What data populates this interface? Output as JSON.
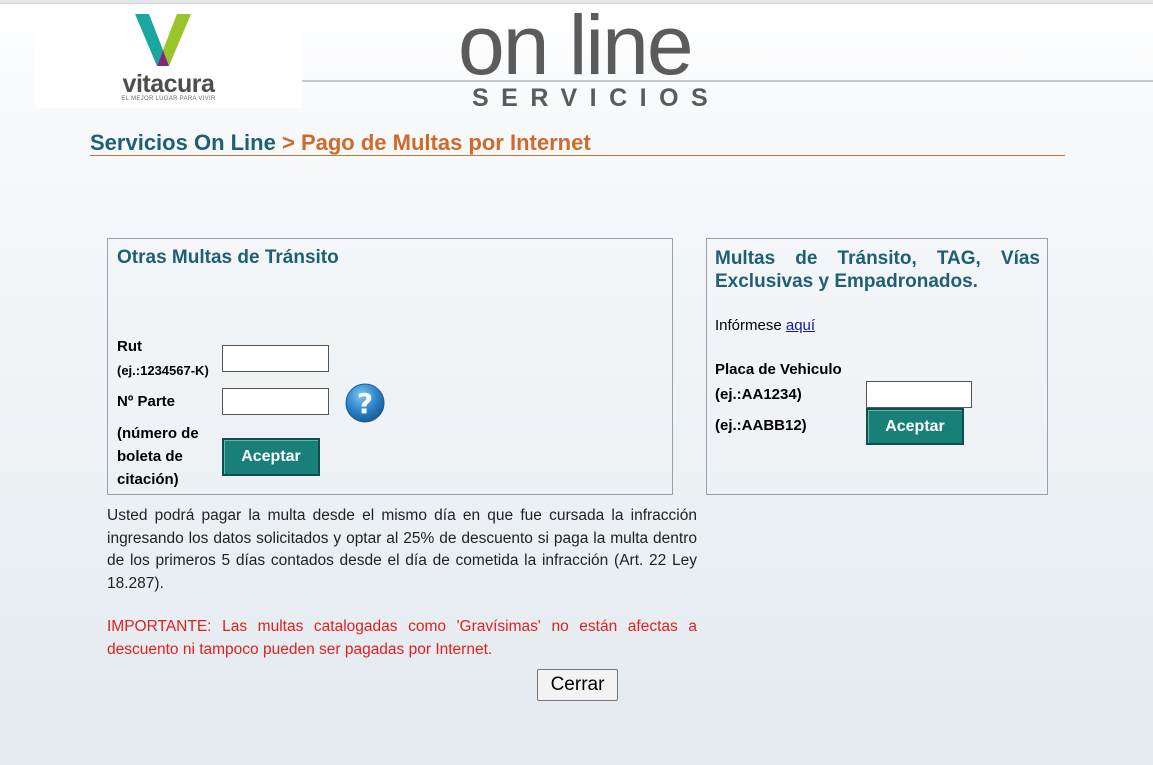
{
  "header": {
    "logo_text": "vitacura",
    "logo_tagline": "EL MEJOR LUGAR PARA VIVIR",
    "title_main": "on line",
    "title_sub": "SERVICIOS"
  },
  "breadcrumb": {
    "home": "Servicios On Line",
    "separator": ">",
    "current": "Pago de Multas por Internet"
  },
  "left_panel": {
    "title": "Otras Multas de Tránsito",
    "rut_label": "Rut",
    "rut_example": "(ej.:1234567-K)",
    "rut_value": "",
    "parte_label": "Nº Parte",
    "parte_value": "",
    "parte_note": [
      "(número de",
      "boleta de",
      "citación)"
    ],
    "submit_label": "Aceptar"
  },
  "right_panel": {
    "title": "Multas de Tránsito, TAG, Vías Exclusivas y Empadronados.",
    "info_prefix": "Infórmese",
    "info_link": "aquí",
    "placa_label": "Placa de Vehiculo",
    "placa_example_1": "(ej.:AA1234)",
    "placa_example_2": "(ej.:AABB12)",
    "placa_value": "",
    "submit_label": "Aceptar"
  },
  "info_text": "Usted podrá pagar la multa desde el mismo día en que fue cursada la infracción ingresando los datos solicitados y optar al 25% de descuento si paga la multa dentro de los primeros 5 días contados desde el día de cometida la infracción (Art. 22 Ley 18.287).",
  "warning_text": "IMPORTANTE: Las multas catalogadas como 'Gravísimas' no están afectas a descuento ni tampoco pueden ser pagadas por Internet.",
  "close_label": "Cerrar",
  "colors": {
    "brand_teal": "#1f5f73",
    "accent_orange": "#d06a2a",
    "button_teal": "#187f79",
    "warning_red": "#e0201f"
  }
}
